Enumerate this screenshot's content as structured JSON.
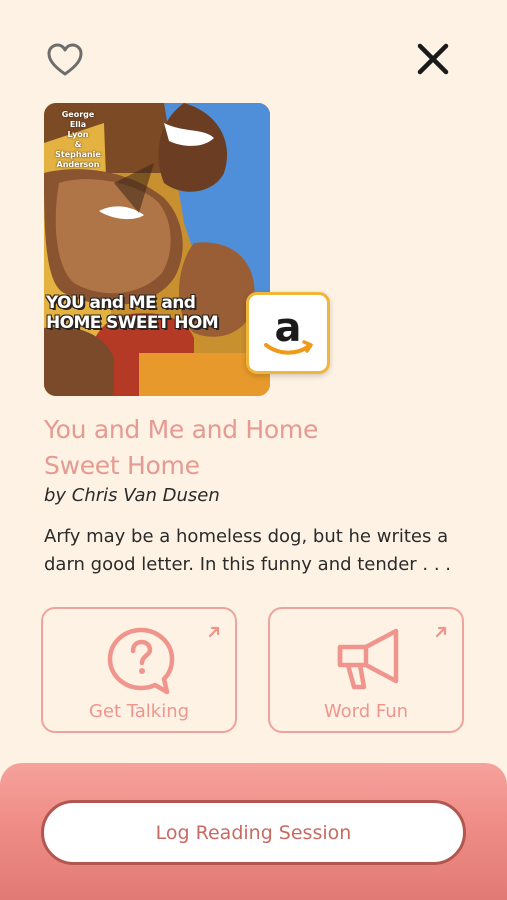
{
  "header": {
    "favorite_icon": "heart-outline-icon",
    "close_icon": "close-x-icon"
  },
  "book": {
    "cover": {
      "authors_text": "George\nElla\nLyon\n&\nStephanie\nAnderson",
      "title_text": "YOU and ME and\nHOME SWEET HOM"
    },
    "store_badge_icon": "amazon-logo-icon",
    "title": "You and Me and Home Sweet Home",
    "author": "by Chris Van Dusen",
    "description": "Arfy may be a homeless dog, but he writes a darn good letter. In this funny and tender . . ."
  },
  "activities": [
    {
      "label": "Get Talking",
      "icon": "question-speech-bubble-icon",
      "link_icon": "arrow-up-right-icon"
    },
    {
      "label": "Word Fun",
      "icon": "megaphone-icon",
      "link_icon": "arrow-up-right-icon"
    }
  ],
  "footer": {
    "log_button_label": "Log Reading Session"
  },
  "colors": {
    "background": "#fdf2e3",
    "accent": "#f0958d",
    "title": "#e59a92",
    "footer_gradient_top": "#f6a29c",
    "footer_gradient_bottom": "#e17a74",
    "button_border": "#b2574f",
    "amazon_orange": "#f0b53c"
  }
}
